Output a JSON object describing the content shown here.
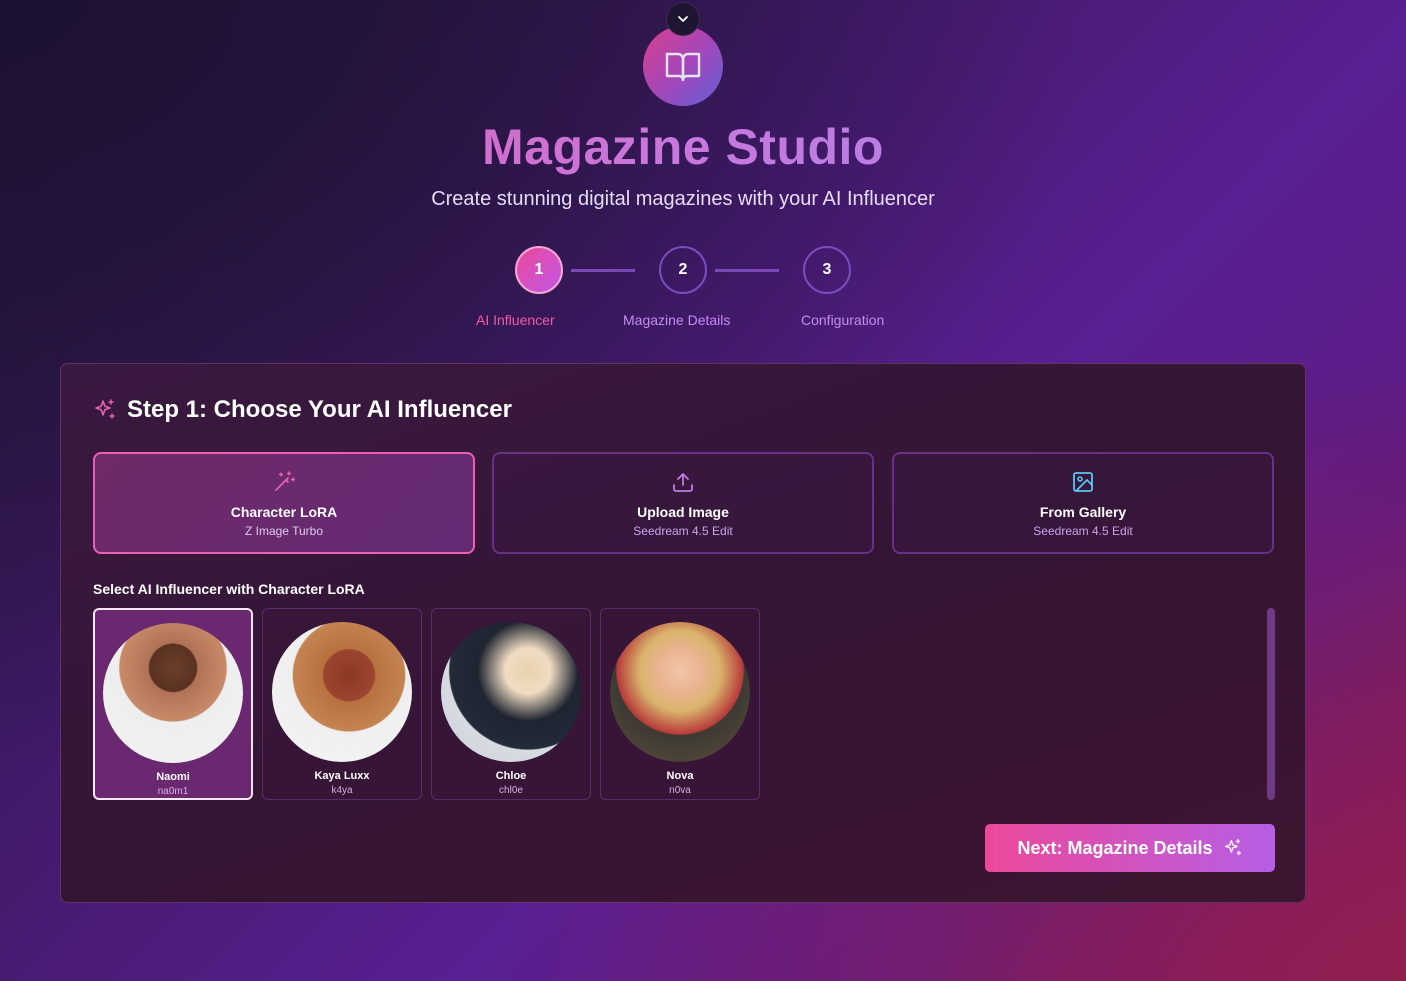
{
  "header": {
    "title": "Magazine Studio",
    "subtitle": "Create stunning digital magazines with your AI Influencer"
  },
  "stepper": [
    {
      "number": "1",
      "label": "AI Influencer",
      "state": "active"
    },
    {
      "number": "2",
      "label": "Magazine Details",
      "state": "inactive"
    },
    {
      "number": "3",
      "label": "Configuration",
      "state": "inactive"
    }
  ],
  "step_card": {
    "title": "Step 1: Choose Your AI Influencer",
    "methods": [
      {
        "name": "Character LoRA",
        "sub": "Z Image Turbo",
        "icon": "magic-wand-icon",
        "selected": true
      },
      {
        "name": "Upload Image",
        "sub": "Seedream 4.5 Edit",
        "icon": "upload-icon",
        "selected": false
      },
      {
        "name": "From Gallery",
        "sub": "Seedream 4.5 Edit",
        "icon": "image-icon",
        "selected": false
      }
    ],
    "section_label": "Select AI Influencer with Character LoRA",
    "influencers": [
      {
        "name": "Naomi",
        "handle": "na0m1",
        "selected": true
      },
      {
        "name": "Kaya Luxx",
        "handle": "k4ya",
        "selected": false
      },
      {
        "name": "Chloe",
        "handle": "chl0e",
        "selected": false
      },
      {
        "name": "Nova",
        "handle": "n0va",
        "selected": false
      }
    ],
    "next_label": "Next: Magazine Details"
  },
  "colors": {
    "accent_pink": "#ec4899",
    "accent_purple": "#b65ee5",
    "step_label_active": "#f25aa8",
    "step_label_inactive": "#c58cf0"
  }
}
